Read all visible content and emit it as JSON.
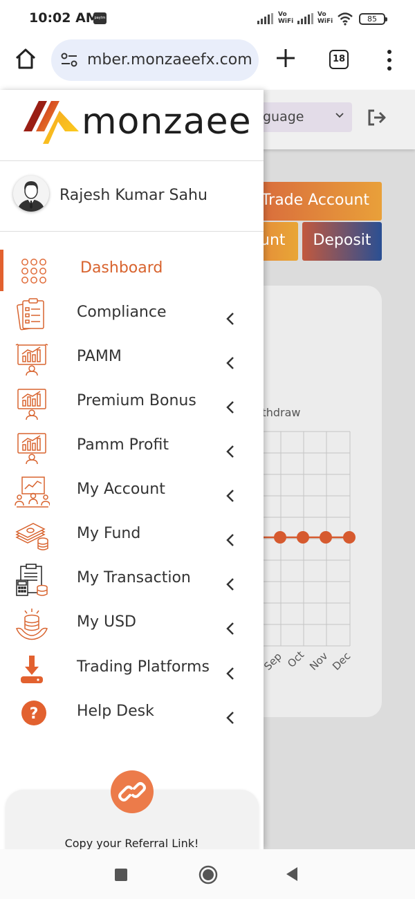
{
  "status_bar": {
    "time": "10:02 AM",
    "paytm_badge": "paytm",
    "vowifi_1": "Vo WiFi",
    "vowifi_2": "Vo WiFi",
    "battery": "85"
  },
  "browser": {
    "url": "mber.monzaeefx.com",
    "tab_count": "18"
  },
  "page_behind": {
    "language_select": "guage",
    "trade_account_button": "Trade Account",
    "account_button_partial": "unt",
    "deposit_button": "Deposit",
    "legend_partial": "ithdraw",
    "chart_months": [
      "Sep",
      "Oct",
      "Nov",
      "Dec"
    ]
  },
  "drawer": {
    "brand": "monzaee",
    "user_name": "Rajesh Kumar Sahu",
    "menu": [
      {
        "label": "Dashboard",
        "icon": "dashboard-grid-icon",
        "active": true
      },
      {
        "label": "Compliance",
        "icon": "compliance-clipboard-icon"
      },
      {
        "label": "PAMM",
        "icon": "pamm-chart-icon"
      },
      {
        "label": "Premium Bonus",
        "icon": "premium-bonus-icon"
      },
      {
        "label": "Pamm Profit",
        "icon": "pamm-profit-icon"
      },
      {
        "label": "My Account",
        "icon": "my-account-presentation-icon"
      },
      {
        "label": "My Fund",
        "icon": "money-stack-icon"
      },
      {
        "label": "My Transaction",
        "icon": "transaction-calculator-icon"
      },
      {
        "label": "My USD",
        "icon": "usd-coins-hand-icon"
      },
      {
        "label": "Trading Platforms",
        "icon": "download-icon"
      },
      {
        "label": "Help Desk",
        "icon": "help-question-icon"
      }
    ],
    "referral_text": "Copy your Referral Link!"
  },
  "colors": {
    "accent_orange": "#d8632e",
    "drawer_bg": "#ffffff",
    "page_bg": "#dcdcdc"
  }
}
